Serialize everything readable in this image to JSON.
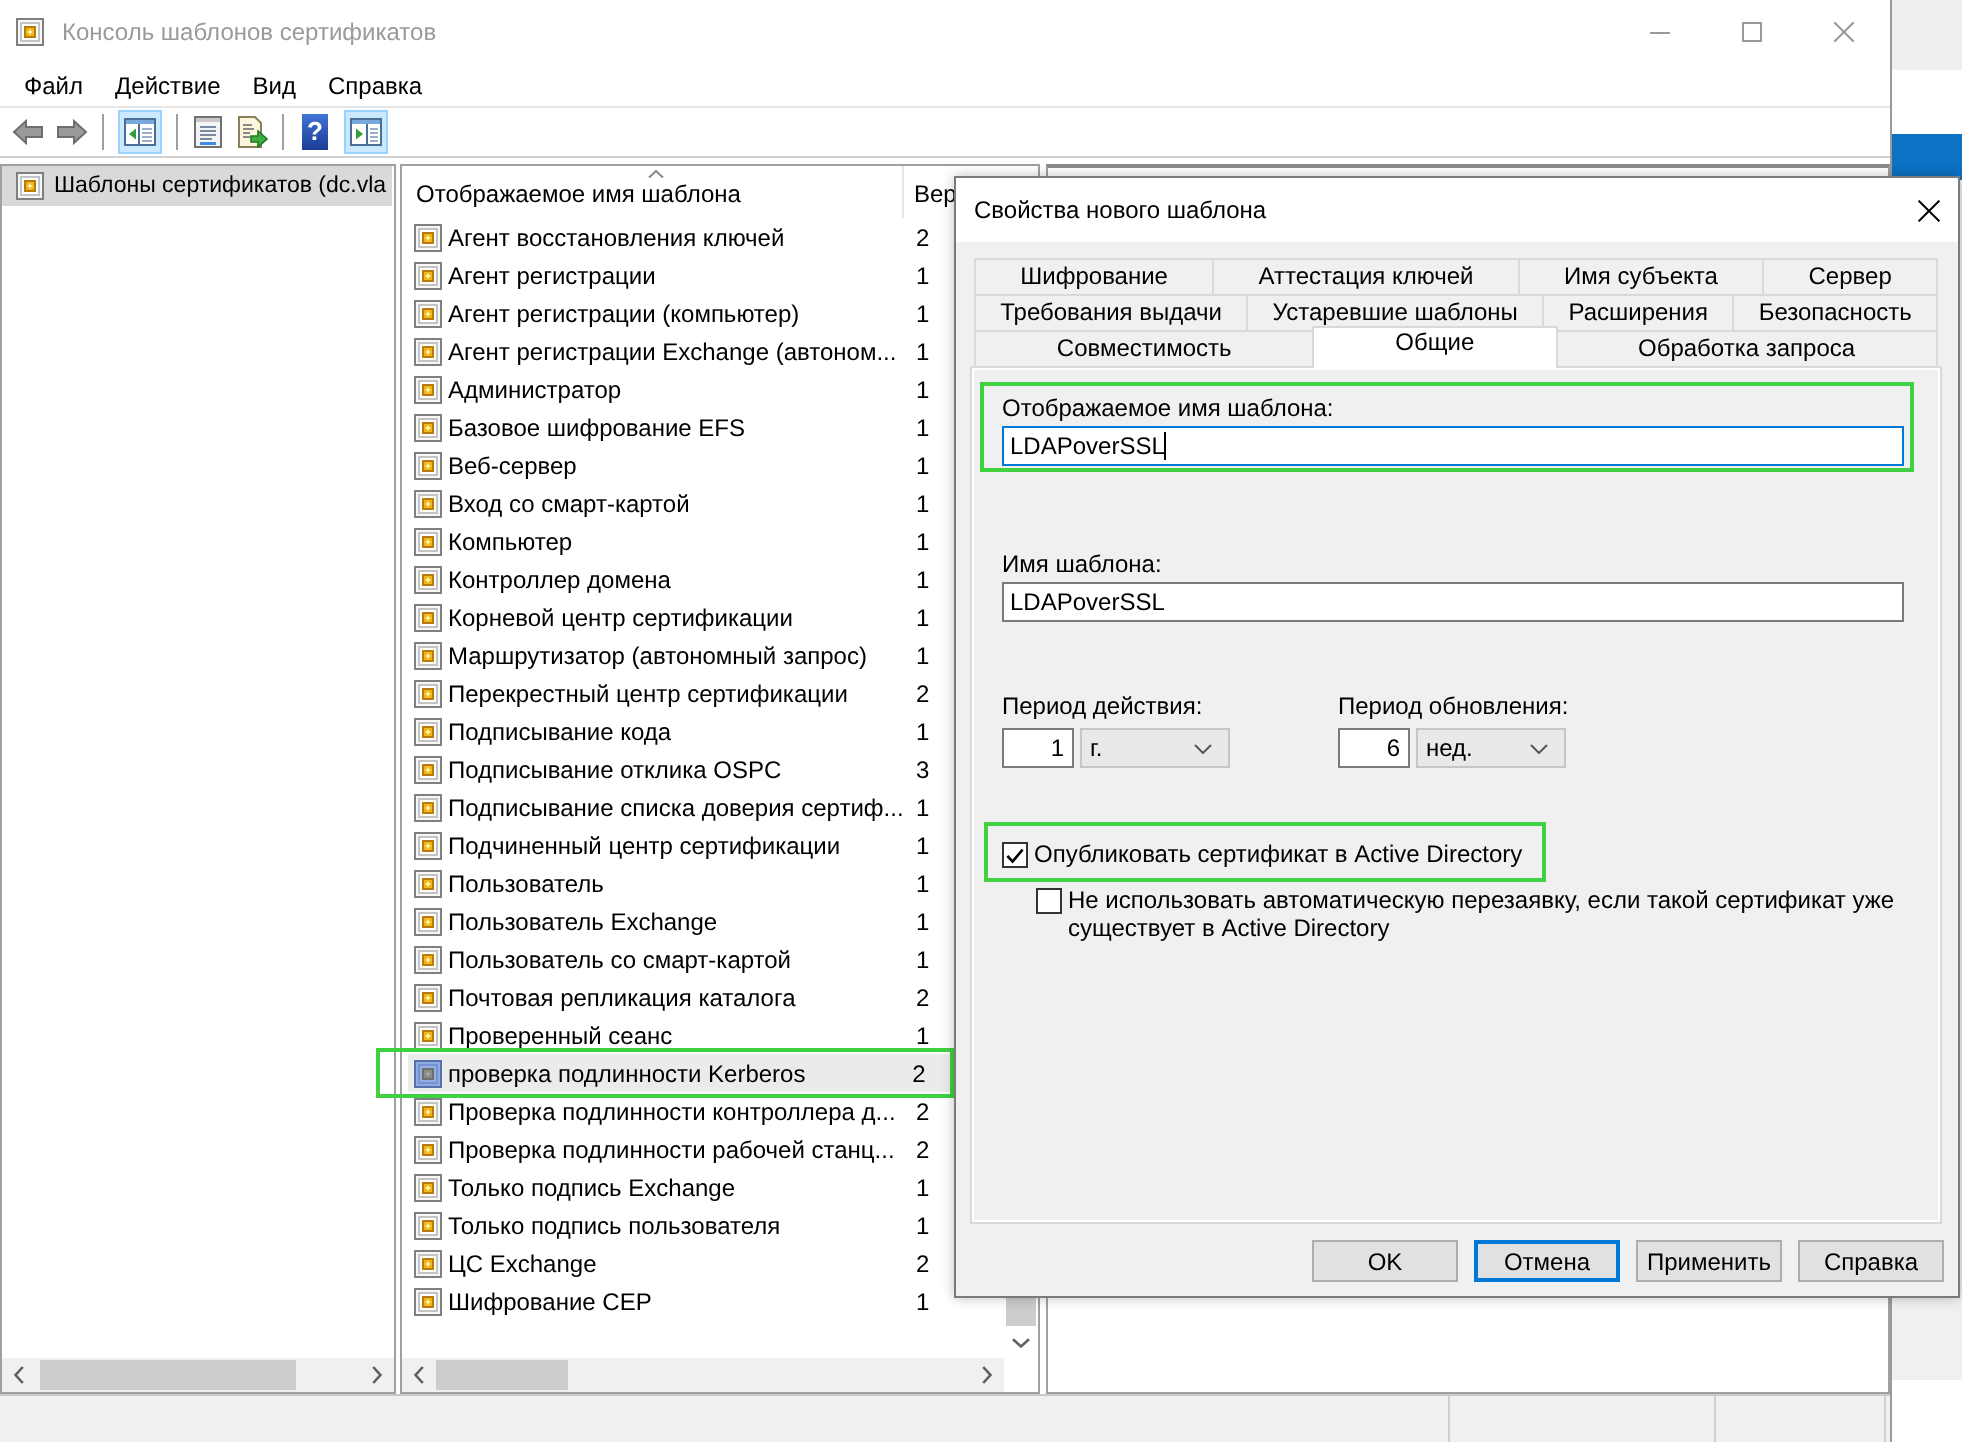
{
  "window": {
    "title": "Консоль шаблонов сертификатов",
    "active": false
  },
  "menu": [
    "Файл",
    "Действие",
    "Вид",
    "Справка"
  ],
  "toolbar": [
    {
      "kind": "back",
      "pressed": false
    },
    {
      "kind": "forward",
      "pressed": false
    },
    {
      "kind": "separator"
    },
    {
      "kind": "console-tree",
      "pressed": true
    },
    {
      "kind": "separator"
    },
    {
      "kind": "properties",
      "pressed": false
    },
    {
      "kind": "export",
      "pressed": false
    },
    {
      "kind": "separator"
    },
    {
      "kind": "help",
      "glyph": "?",
      "pressed": false
    },
    {
      "kind": "action-pane",
      "pressed": true
    }
  ],
  "tree": {
    "items": [
      {
        "label": "Шаблоны сертификатов (dc.vla",
        "selected": true
      }
    ]
  },
  "template_list": {
    "columns": [
      {
        "label": "Отображаемое имя шаблона",
        "sorted": true
      },
      {
        "label": "Вер",
        "sorted": false
      }
    ],
    "rows": [
      {
        "name": "Агент восстановления ключей",
        "version": "2",
        "selected": false,
        "highlighted": false
      },
      {
        "name": "Агент регистрации",
        "version": "1",
        "selected": false,
        "highlighted": false
      },
      {
        "name": "Агент регистрации (компьютер)",
        "version": "1",
        "selected": false,
        "highlighted": false
      },
      {
        "name": "Агент регистрации Exchange (автоном...",
        "version": "1",
        "selected": false,
        "highlighted": false
      },
      {
        "name": "Администратор",
        "version": "1",
        "selected": false,
        "highlighted": false
      },
      {
        "name": "Базовое шифрование EFS",
        "version": "1",
        "selected": false,
        "highlighted": false
      },
      {
        "name": "Веб-сервер",
        "version": "1",
        "selected": false,
        "highlighted": false
      },
      {
        "name": "Вход со смарт-картой",
        "version": "1",
        "selected": false,
        "highlighted": false
      },
      {
        "name": "Компьютер",
        "version": "1",
        "selected": false,
        "highlighted": false
      },
      {
        "name": "Контроллер домена",
        "version": "1",
        "selected": false,
        "highlighted": false
      },
      {
        "name": "Корневой центр сертификации",
        "version": "1",
        "selected": false,
        "highlighted": false
      },
      {
        "name": "Маршрутизатор (автономный запрос)",
        "version": "1",
        "selected": false,
        "highlighted": false
      },
      {
        "name": "Перекрестный центр сертификации",
        "version": "2",
        "selected": false,
        "highlighted": false
      },
      {
        "name": "Подписывание кода",
        "version": "1",
        "selected": false,
        "highlighted": false
      },
      {
        "name": "Подписывание отклика OSPC",
        "version": "3",
        "selected": false,
        "highlighted": false
      },
      {
        "name": "Подписывание списка доверия сертиф...",
        "version": "1",
        "selected": false,
        "highlighted": false
      },
      {
        "name": "Подчиненный центр сертификации",
        "version": "1",
        "selected": false,
        "highlighted": false
      },
      {
        "name": "Пользователь",
        "version": "1",
        "selected": false,
        "highlighted": false
      },
      {
        "name": "Пользователь Exchange",
        "version": "1",
        "selected": false,
        "highlighted": false
      },
      {
        "name": "Пользователь со смарт-картой",
        "version": "1",
        "selected": false,
        "highlighted": false
      },
      {
        "name": "Почтовая репликация каталога",
        "version": "2",
        "selected": false,
        "highlighted": false
      },
      {
        "name": "Проверенный сеанс",
        "version": "1",
        "selected": false,
        "highlighted": false
      },
      {
        "name": "проверка подлинности Kerberos",
        "version": "2",
        "selected": true,
        "highlighted": true
      },
      {
        "name": "Проверка подлинности контроллера д...",
        "version": "2",
        "selected": false,
        "highlighted": false
      },
      {
        "name": "Проверка подлинности рабочей станц...",
        "version": "2",
        "selected": false,
        "highlighted": false
      },
      {
        "name": "Только подпись Exchange",
        "version": "1",
        "selected": false,
        "highlighted": false
      },
      {
        "name": "Только подпись пользователя",
        "version": "1",
        "selected": false,
        "highlighted": false
      },
      {
        "name": "ЦС Exchange",
        "version": "2",
        "selected": false,
        "highlighted": false
      },
      {
        "name": "Шифрование CEP",
        "version": "1",
        "selected": false,
        "highlighted": false
      }
    ]
  },
  "dialog": {
    "title": "Свойства нового шаблона",
    "tab_rows": [
      [
        {
          "label": "Шифрование",
          "selected": false
        },
        {
          "label": "Аттестация ключей",
          "selected": false
        },
        {
          "label": "Имя субъекта",
          "selected": false
        },
        {
          "label": "Сервер",
          "selected": false
        }
      ],
      [
        {
          "label": "Требования выдачи",
          "selected": false
        },
        {
          "label": "Устаревшие шаблоны",
          "selected": false
        },
        {
          "label": "Расширения",
          "selected": false
        },
        {
          "label": "Безопасность",
          "selected": false
        }
      ],
      [
        {
          "label": "Совместимость",
          "selected": false
        },
        {
          "label": "Общие",
          "selected": true
        },
        {
          "label": "Обработка запроса",
          "selected": false
        }
      ]
    ],
    "fields": [
      {
        "label": "Отображаемое имя шаблона:",
        "value": "LDAPoverSSL",
        "focused": true,
        "highlighted": true
      },
      {
        "label": "Имя шаблона:",
        "value": "LDAPoverSSL",
        "focused": false,
        "highlighted": false
      }
    ],
    "periods": [
      {
        "label": "Период действия:",
        "number": "1",
        "unit": "г."
      },
      {
        "label": "Период обновления:",
        "number": "6",
        "unit": "нед."
      }
    ],
    "checkboxes": [
      {
        "label": "Опубликовать сертификат в Active Directory",
        "checked": true,
        "highlighted": true,
        "children": [
          {
            "label": "Не использовать автоматическую перезаявку, если такой сертификат уже существует в Active Directory",
            "checked": false,
            "highlighted": false
          }
        ]
      }
    ],
    "buttons": [
      {
        "label": "OK",
        "focused": false
      },
      {
        "label": "Отмена",
        "focused": true
      },
      {
        "label": "Применить",
        "focused": false
      },
      {
        "label": "Справка",
        "focused": false
      }
    ]
  }
}
